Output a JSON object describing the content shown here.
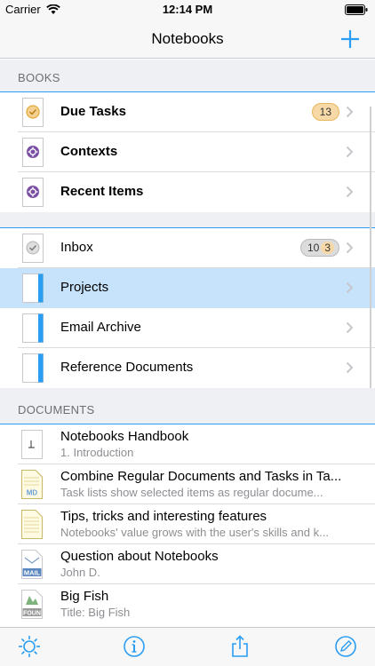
{
  "status": {
    "carrier": "Carrier",
    "time": "12:14 PM"
  },
  "nav": {
    "title": "Notebooks"
  },
  "books_section": {
    "header": "BOOKS",
    "items": [
      {
        "label": "Due Tasks",
        "bold": true,
        "badge": "13",
        "icon": "due-tasks-icon"
      },
      {
        "label": "Contexts",
        "bold": true,
        "icon": "gear-icon"
      },
      {
        "label": "Recent Items",
        "bold": true,
        "icon": "gear-icon"
      }
    ]
  },
  "notebooks_section": {
    "items": [
      {
        "label": "Inbox",
        "badge_a": "10",
        "badge_b": "3",
        "icon": "inbox-icon"
      },
      {
        "label": "Projects",
        "selected": true,
        "icon": "notebook-icon"
      },
      {
        "label": "Email Archive",
        "icon": "notebook-icon"
      },
      {
        "label": "Reference Documents",
        "icon": "notebook-icon"
      }
    ]
  },
  "documents_section": {
    "header": "DOCUMENTS",
    "items": [
      {
        "title": "Notebooks Handbook",
        "subtitle": "1. Introduction",
        "icon": "handbook-icon"
      },
      {
        "title": "Combine Regular Documents and Tasks in Ta...",
        "subtitle": "Task lists show selected items as regular docume...",
        "icon": "md-icon",
        "badge": "MD"
      },
      {
        "title": "Tips, tricks and interesting features",
        "subtitle": "Notebooks' value grows with the user's skills and k...",
        "icon": "lined-doc-icon"
      },
      {
        "title": "Question about Notebooks",
        "subtitle": "John D.",
        "icon": "mail-icon",
        "badge": "MAIL"
      },
      {
        "title": "Big Fish",
        "subtitle": "Title: Big Fish",
        "icon": "foun-icon",
        "badge": "FOUN"
      }
    ]
  },
  "colors": {
    "accent": "#2a9df4",
    "selected_row": "#c6e3fb",
    "badge": "#f7d9a7"
  }
}
